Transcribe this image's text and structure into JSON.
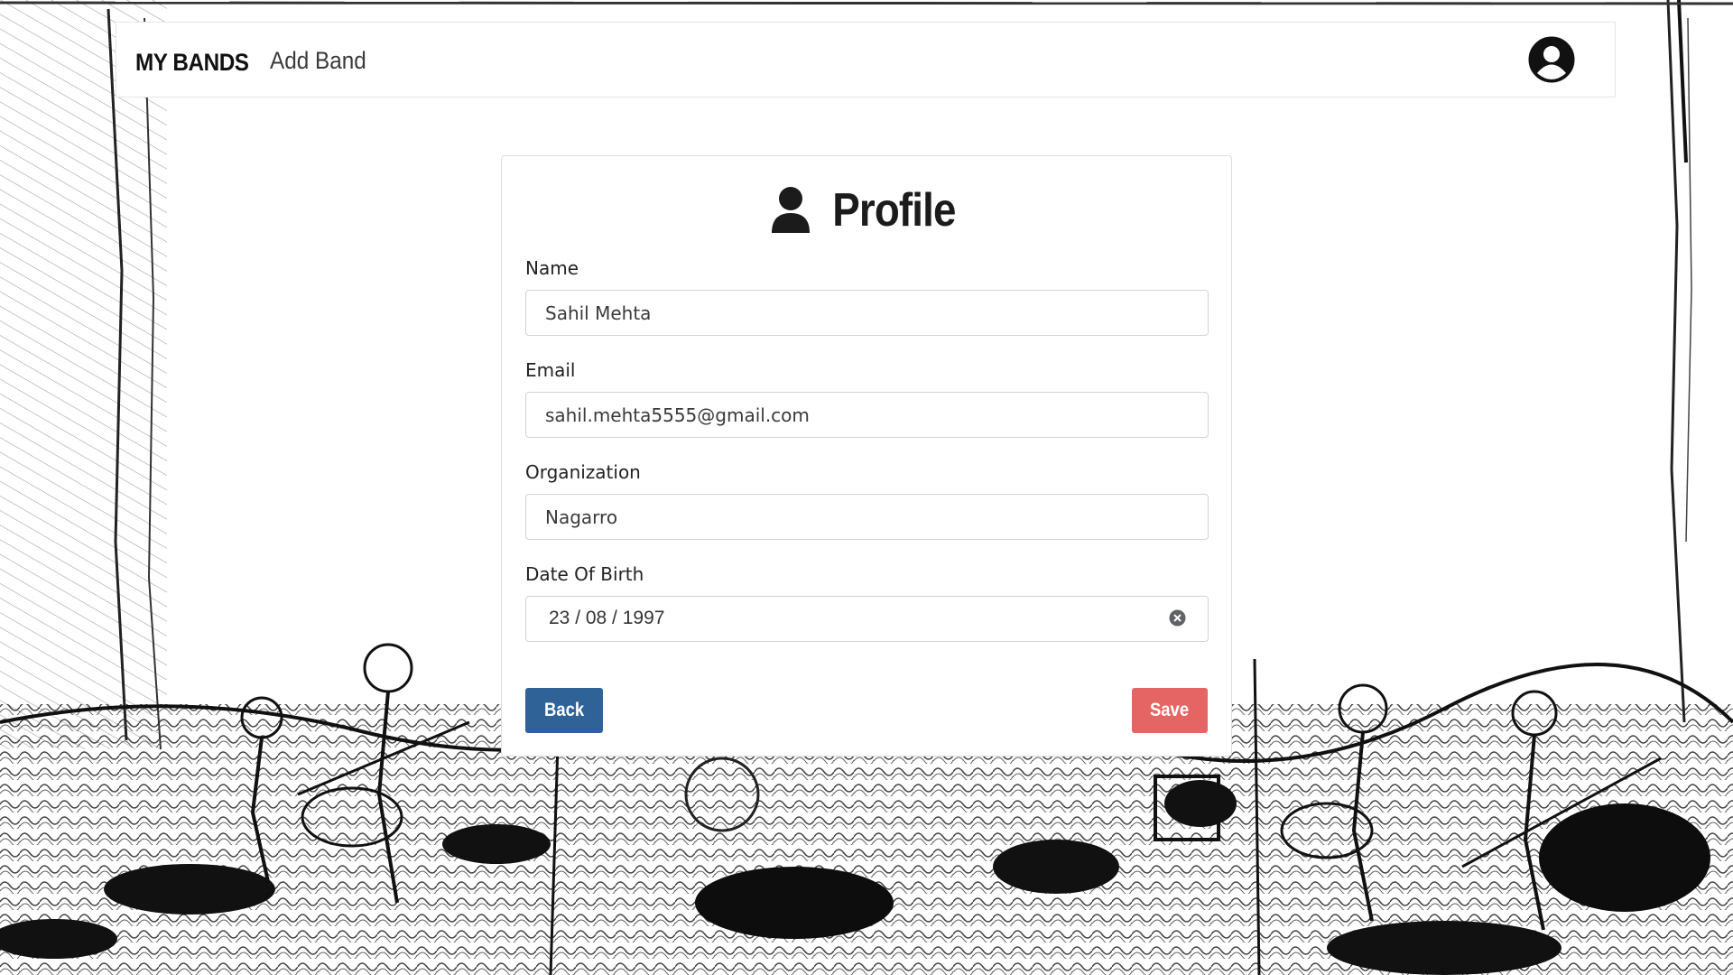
{
  "navbar": {
    "brand": "MY BANDS",
    "add_band": "Add Band",
    "profile_icon": "user-circle-icon"
  },
  "card": {
    "title_icon": "user-icon",
    "title": "Profile",
    "fields": {
      "name": {
        "label": "Name",
        "value": "Sahil Mehta"
      },
      "email": {
        "label": "Email",
        "value": "sahil.mehta5555@gmail.com"
      },
      "organization": {
        "label": "Organization",
        "value": "Nagarro"
      },
      "dob": {
        "label": "Date Of Birth",
        "value": "23 / 08 / 1997",
        "clear_icon": "clear-circle-icon"
      }
    },
    "back_label": "Back",
    "save_label": "Save"
  },
  "colors": {
    "back_button": "#2f6398",
    "save_button": "#e56565",
    "navbar_border": "#e6e6e6"
  }
}
